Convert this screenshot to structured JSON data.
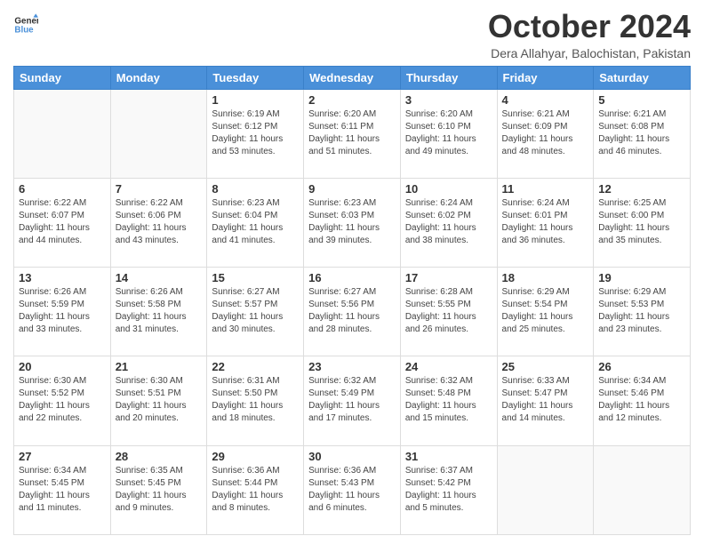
{
  "header": {
    "logo_line1": "General",
    "logo_line2": "Blue",
    "month_title": "October 2024",
    "subtitle": "Dera Allahyar, Balochistan, Pakistan"
  },
  "weekdays": [
    "Sunday",
    "Monday",
    "Tuesday",
    "Wednesday",
    "Thursday",
    "Friday",
    "Saturday"
  ],
  "weeks": [
    [
      {
        "day": "",
        "sunrise": "",
        "sunset": "",
        "daylight": ""
      },
      {
        "day": "",
        "sunrise": "",
        "sunset": "",
        "daylight": ""
      },
      {
        "day": "1",
        "sunrise": "Sunrise: 6:19 AM",
        "sunset": "Sunset: 6:12 PM",
        "daylight": "Daylight: 11 hours and 53 minutes."
      },
      {
        "day": "2",
        "sunrise": "Sunrise: 6:20 AM",
        "sunset": "Sunset: 6:11 PM",
        "daylight": "Daylight: 11 hours and 51 minutes."
      },
      {
        "day": "3",
        "sunrise": "Sunrise: 6:20 AM",
        "sunset": "Sunset: 6:10 PM",
        "daylight": "Daylight: 11 hours and 49 minutes."
      },
      {
        "day": "4",
        "sunrise": "Sunrise: 6:21 AM",
        "sunset": "Sunset: 6:09 PM",
        "daylight": "Daylight: 11 hours and 48 minutes."
      },
      {
        "day": "5",
        "sunrise": "Sunrise: 6:21 AM",
        "sunset": "Sunset: 6:08 PM",
        "daylight": "Daylight: 11 hours and 46 minutes."
      }
    ],
    [
      {
        "day": "6",
        "sunrise": "Sunrise: 6:22 AM",
        "sunset": "Sunset: 6:07 PM",
        "daylight": "Daylight: 11 hours and 44 minutes."
      },
      {
        "day": "7",
        "sunrise": "Sunrise: 6:22 AM",
        "sunset": "Sunset: 6:06 PM",
        "daylight": "Daylight: 11 hours and 43 minutes."
      },
      {
        "day": "8",
        "sunrise": "Sunrise: 6:23 AM",
        "sunset": "Sunset: 6:04 PM",
        "daylight": "Daylight: 11 hours and 41 minutes."
      },
      {
        "day": "9",
        "sunrise": "Sunrise: 6:23 AM",
        "sunset": "Sunset: 6:03 PM",
        "daylight": "Daylight: 11 hours and 39 minutes."
      },
      {
        "day": "10",
        "sunrise": "Sunrise: 6:24 AM",
        "sunset": "Sunset: 6:02 PM",
        "daylight": "Daylight: 11 hours and 38 minutes."
      },
      {
        "day": "11",
        "sunrise": "Sunrise: 6:24 AM",
        "sunset": "Sunset: 6:01 PM",
        "daylight": "Daylight: 11 hours and 36 minutes."
      },
      {
        "day": "12",
        "sunrise": "Sunrise: 6:25 AM",
        "sunset": "Sunset: 6:00 PM",
        "daylight": "Daylight: 11 hours and 35 minutes."
      }
    ],
    [
      {
        "day": "13",
        "sunrise": "Sunrise: 6:26 AM",
        "sunset": "Sunset: 5:59 PM",
        "daylight": "Daylight: 11 hours and 33 minutes."
      },
      {
        "day": "14",
        "sunrise": "Sunrise: 6:26 AM",
        "sunset": "Sunset: 5:58 PM",
        "daylight": "Daylight: 11 hours and 31 minutes."
      },
      {
        "day": "15",
        "sunrise": "Sunrise: 6:27 AM",
        "sunset": "Sunset: 5:57 PM",
        "daylight": "Daylight: 11 hours and 30 minutes."
      },
      {
        "day": "16",
        "sunrise": "Sunrise: 6:27 AM",
        "sunset": "Sunset: 5:56 PM",
        "daylight": "Daylight: 11 hours and 28 minutes."
      },
      {
        "day": "17",
        "sunrise": "Sunrise: 6:28 AM",
        "sunset": "Sunset: 5:55 PM",
        "daylight": "Daylight: 11 hours and 26 minutes."
      },
      {
        "day": "18",
        "sunrise": "Sunrise: 6:29 AM",
        "sunset": "Sunset: 5:54 PM",
        "daylight": "Daylight: 11 hours and 25 minutes."
      },
      {
        "day": "19",
        "sunrise": "Sunrise: 6:29 AM",
        "sunset": "Sunset: 5:53 PM",
        "daylight": "Daylight: 11 hours and 23 minutes."
      }
    ],
    [
      {
        "day": "20",
        "sunrise": "Sunrise: 6:30 AM",
        "sunset": "Sunset: 5:52 PM",
        "daylight": "Daylight: 11 hours and 22 minutes."
      },
      {
        "day": "21",
        "sunrise": "Sunrise: 6:30 AM",
        "sunset": "Sunset: 5:51 PM",
        "daylight": "Daylight: 11 hours and 20 minutes."
      },
      {
        "day": "22",
        "sunrise": "Sunrise: 6:31 AM",
        "sunset": "Sunset: 5:50 PM",
        "daylight": "Daylight: 11 hours and 18 minutes."
      },
      {
        "day": "23",
        "sunrise": "Sunrise: 6:32 AM",
        "sunset": "Sunset: 5:49 PM",
        "daylight": "Daylight: 11 hours and 17 minutes."
      },
      {
        "day": "24",
        "sunrise": "Sunrise: 6:32 AM",
        "sunset": "Sunset: 5:48 PM",
        "daylight": "Daylight: 11 hours and 15 minutes."
      },
      {
        "day": "25",
        "sunrise": "Sunrise: 6:33 AM",
        "sunset": "Sunset: 5:47 PM",
        "daylight": "Daylight: 11 hours and 14 minutes."
      },
      {
        "day": "26",
        "sunrise": "Sunrise: 6:34 AM",
        "sunset": "Sunset: 5:46 PM",
        "daylight": "Daylight: 11 hours and 12 minutes."
      }
    ],
    [
      {
        "day": "27",
        "sunrise": "Sunrise: 6:34 AM",
        "sunset": "Sunset: 5:45 PM",
        "daylight": "Daylight: 11 hours and 11 minutes."
      },
      {
        "day": "28",
        "sunrise": "Sunrise: 6:35 AM",
        "sunset": "Sunset: 5:45 PM",
        "daylight": "Daylight: 11 hours and 9 minutes."
      },
      {
        "day": "29",
        "sunrise": "Sunrise: 6:36 AM",
        "sunset": "Sunset: 5:44 PM",
        "daylight": "Daylight: 11 hours and 8 minutes."
      },
      {
        "day": "30",
        "sunrise": "Sunrise: 6:36 AM",
        "sunset": "Sunset: 5:43 PM",
        "daylight": "Daylight: 11 hours and 6 minutes."
      },
      {
        "day": "31",
        "sunrise": "Sunrise: 6:37 AM",
        "sunset": "Sunset: 5:42 PM",
        "daylight": "Daylight: 11 hours and 5 minutes."
      },
      {
        "day": "",
        "sunrise": "",
        "sunset": "",
        "daylight": ""
      },
      {
        "day": "",
        "sunrise": "",
        "sunset": "",
        "daylight": ""
      }
    ]
  ]
}
